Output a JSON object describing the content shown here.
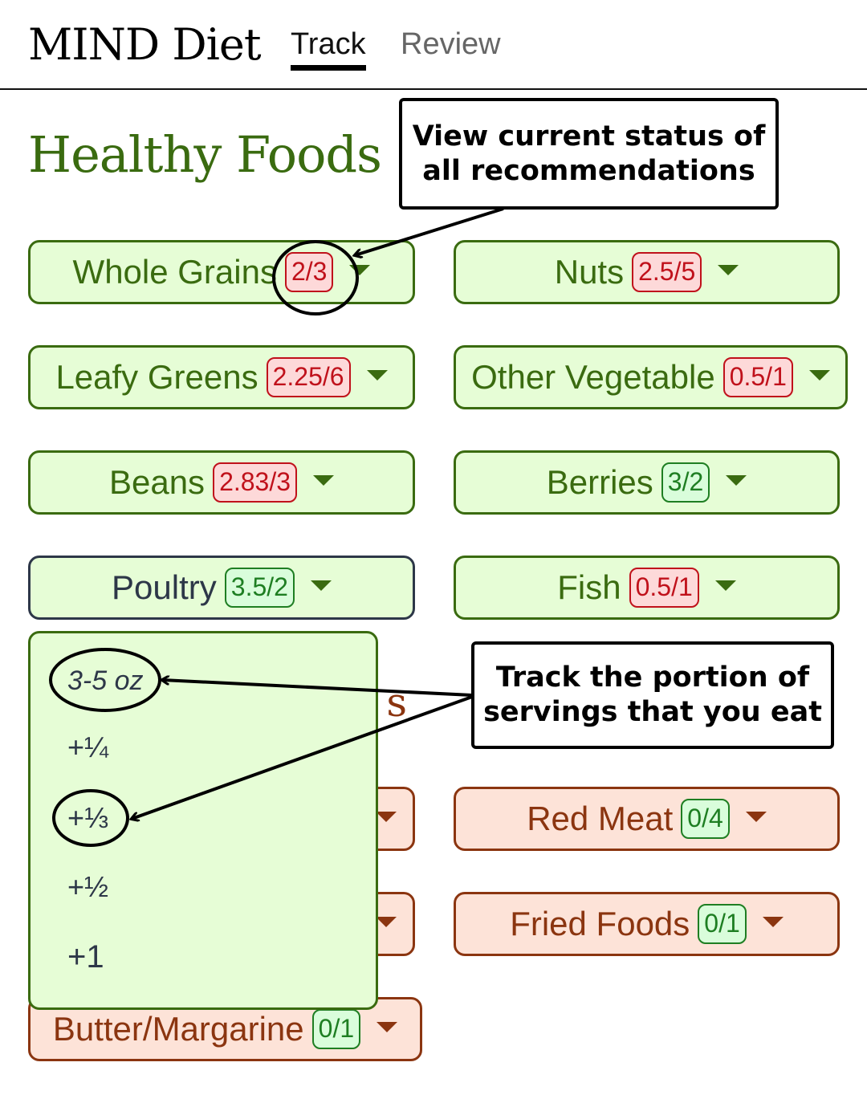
{
  "header": {
    "brand": "MIND Diet",
    "tabs": [
      {
        "label": "Track",
        "active": true
      },
      {
        "label": "Review",
        "active": false
      }
    ]
  },
  "healthy": {
    "title": "Healthy Foods",
    "items": [
      {
        "label": "Whole Grains",
        "badge": "2/3",
        "status": "under"
      },
      {
        "label": "Nuts",
        "badge": "2.5/5",
        "status": "under"
      },
      {
        "label": "Leafy Greens",
        "badge": "2.25/6",
        "status": "under"
      },
      {
        "label": "Other Vegetable",
        "badge": "0.5/1",
        "status": "under"
      },
      {
        "label": "Beans",
        "badge": "2.83/3",
        "status": "under"
      },
      {
        "label": "Berries",
        "badge": "3/2",
        "status": "met"
      },
      {
        "label": "Poultry",
        "badge": "3.5/2",
        "status": "met",
        "focused": true
      },
      {
        "label": "Fish",
        "badge": "0.5/1",
        "status": "under"
      }
    ]
  },
  "unhealthy": {
    "title_visible_fragment": "s",
    "items": [
      {
        "label": "Red Meat",
        "badge": "0/4",
        "status": "met"
      },
      {
        "label": "Fried Foods",
        "badge": "0/1",
        "status": "met"
      },
      {
        "label": "Butter/Margarine",
        "badge": "0/1",
        "status": "met"
      }
    ]
  },
  "dropdown": {
    "serving_size": "3-5 oz",
    "options": [
      "+¼",
      "+⅓",
      "+½",
      "+1"
    ]
  },
  "annotations": {
    "status_callout": "View current status of all recommendations",
    "portion_callout": "Track the portion of servings that you eat"
  },
  "colors": {
    "healthy_text": "#3a6b10",
    "healthy_bg": "#e6fdd6",
    "unhealthy_text": "#8b3510",
    "unhealthy_bg": "#fde3d8",
    "badge_under": "#c0111b",
    "badge_met": "#1e7e22"
  }
}
